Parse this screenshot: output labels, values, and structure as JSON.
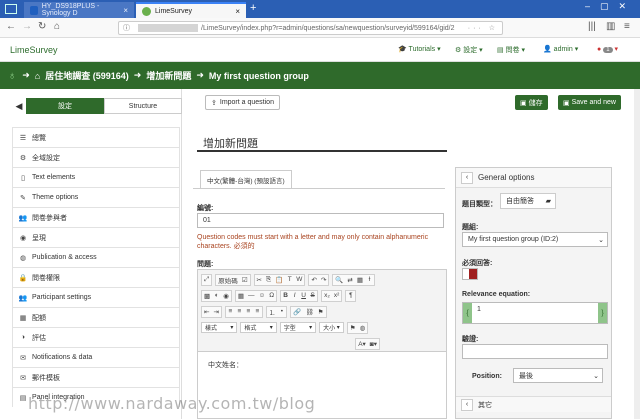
{
  "browser": {
    "tabs": [
      {
        "label": "HY_DS918PLUS - Synology D",
        "color": "#1f5fbf"
      },
      {
        "label": "LimeSurvey",
        "color": "#6ab04c"
      }
    ],
    "url": "/LimeSurvey/index.php?r=admin/questions/sa/newquestion/surveyid/599164/gid/2"
  },
  "topnav": {
    "brand": "LimeSurvey",
    "tutorials": "Tutorials",
    "settings": "設定",
    "surveys": "問卷",
    "user": "admin",
    "notifications": "1"
  },
  "breadcrumb": [
    "居住地調查 (599164)",
    "增加新問題",
    "My first question group"
  ],
  "sidebar": {
    "tabs": [
      "設定",
      "Structure"
    ],
    "items": [
      {
        "icon": "list-icon",
        "glyph": "☰",
        "label": "總覽"
      },
      {
        "icon": "gears-icon",
        "glyph": "⚙",
        "label": "全域設定"
      },
      {
        "icon": "file-icon",
        "glyph": "▯",
        "label": "Text elements"
      },
      {
        "icon": "paint-icon",
        "glyph": "✎",
        "label": "Theme options"
      },
      {
        "icon": "users-icon",
        "glyph": "👥",
        "label": "問卷參與者"
      },
      {
        "icon": "eye-icon",
        "glyph": "◉",
        "label": "呈現"
      },
      {
        "icon": "globe-icon",
        "glyph": "◍",
        "label": "Publication & access"
      },
      {
        "icon": "lock-icon",
        "glyph": "🔒",
        "label": "問卷權限"
      },
      {
        "icon": "participants-icon",
        "glyph": "👥",
        "label": "Participant settings"
      },
      {
        "icon": "quota-icon",
        "glyph": "▦",
        "label": "配額"
      },
      {
        "icon": "assessment-icon",
        "glyph": "◑",
        "label": "評估"
      },
      {
        "icon": "envelope-icon",
        "glyph": "✉",
        "label": "Notifications & data"
      },
      {
        "icon": "mail-template-icon",
        "glyph": "✉",
        "label": "郵件模板"
      },
      {
        "icon": "panel-icon",
        "glyph": "▤",
        "label": "Panel integration"
      }
    ]
  },
  "toolbar": {
    "import": "Import a question",
    "save": "儲存",
    "save_new": "Save and new"
  },
  "main": {
    "title": "增加新問題",
    "language_tab": "中文(繁體-台灣) (預設語言)",
    "code_label": "編號:",
    "code_value": "01",
    "code_error": "Question codes must start with a letter and may only contain alphanumeric characters. 必須的",
    "question_label": "問題:",
    "editor": {
      "source": "原始碼",
      "styles": "樣式",
      "format": "格式",
      "font": "字型",
      "size": "大小",
      "text": "中文姓名："
    }
  },
  "right_panel": {
    "header": "General options",
    "question_type_label": "題目類型：",
    "question_type_value": "自由簡答",
    "group_label": "題組:",
    "group_value": "My first question group (ID:2)",
    "mandatory_label": "必須回答:",
    "relevance_label": "Relevance equation:",
    "relevance_value": "1",
    "validation_label": "驗證:",
    "position_label": "Position:",
    "position_value": "最後",
    "other": "其它"
  },
  "watermark": "http://www.nardaway.com.tw/blog"
}
